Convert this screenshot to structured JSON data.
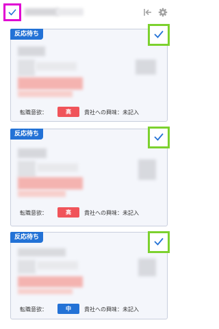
{
  "header": {
    "icons": [
      "checkbox-checked-icon",
      "collapse-left-icon",
      "gear-icon"
    ]
  },
  "colors": {
    "accent": "#2372d6",
    "high": "#f0545a",
    "mid": "#2372d6",
    "green_outline": "#7cd12e",
    "magenta_outline": "#e000d2"
  },
  "cards": [
    {
      "status": "反応待ち",
      "willingness_label": "転職意欲：",
      "level": "高",
      "interest_text": "貴社への興味：未記入"
    },
    {
      "status": "反応待ち",
      "willingness_label": "転職意欲：",
      "level": "高",
      "interest_text": "貴社への興味：未記入"
    },
    {
      "status": "反応待ち",
      "willingness_label": "転職意欲：",
      "level": "中",
      "interest_text": "貴社への興味：未記入"
    }
  ]
}
